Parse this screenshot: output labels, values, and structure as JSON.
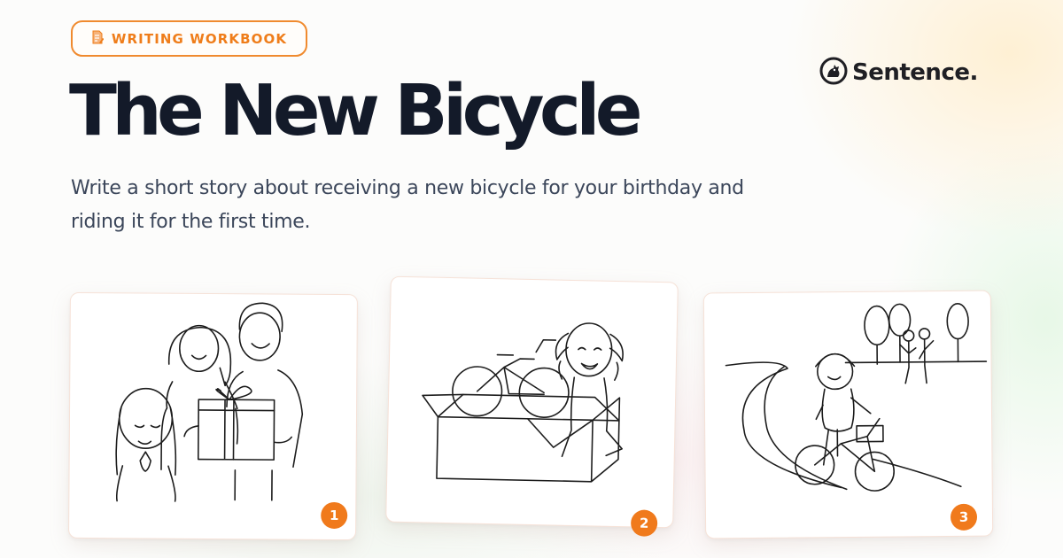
{
  "badge": {
    "icon": "pencil-paper-icon",
    "label": "WRITING WORKBOOK",
    "accent": "#f08a2e"
  },
  "logo": {
    "icon": "cat-logo-icon",
    "text": "Sentence."
  },
  "title": "The New Bicycle",
  "description": "Write a short story about receiving a new bicycle for your birthday and riding it for the first time.",
  "panels": [
    {
      "number": "1",
      "scene": "family-gift-scene"
    },
    {
      "number": "2",
      "scene": "bicycle-box-scene"
    },
    {
      "number": "3",
      "scene": "girl-riding-bike-scene"
    }
  ],
  "colors": {
    "title": "#131a29",
    "text": "#3b465a",
    "accent": "#f07a1c"
  }
}
